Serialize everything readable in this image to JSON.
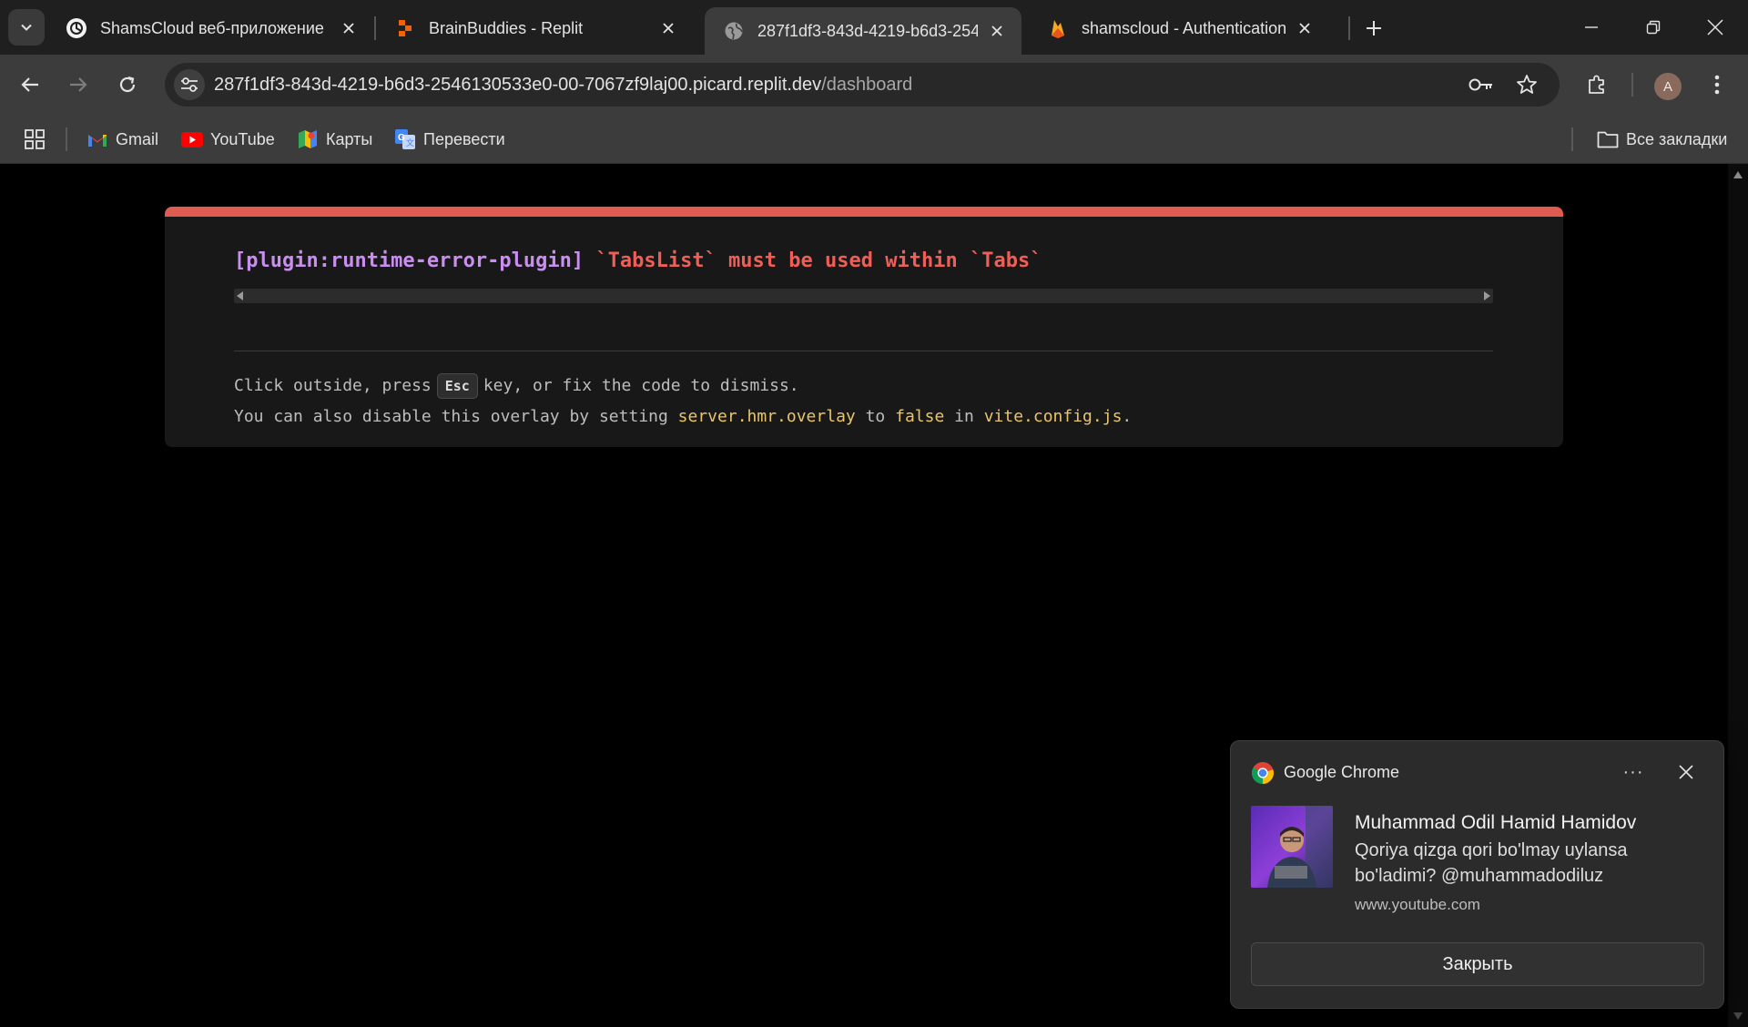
{
  "browser": {
    "tabs": [
      {
        "title": "ShamsCloud веб-приложение",
        "icon": "chatgpt-icon",
        "active": false
      },
      {
        "title": "BrainBuddies - Replit",
        "icon": "replit-icon",
        "active": false
      },
      {
        "title": "287f1df3-843d-4219-b6d3-254",
        "icon": "globe-icon",
        "active": true
      },
      {
        "title": "shamscloud - Authentication - S",
        "icon": "firebase-icon",
        "active": false
      }
    ],
    "url_host": "287f1df3-843d-4219-b6d3-2546130533e0-00-7067zf9laj00.picard.replit.dev",
    "url_path": "/dashboard",
    "profile_initial": "A",
    "bookmarks": [
      {
        "label": "Gmail",
        "icon": "gmail-icon"
      },
      {
        "label": "YouTube",
        "icon": "youtube-icon"
      },
      {
        "label": "Карты",
        "icon": "maps-icon"
      },
      {
        "label": "Перевести",
        "icon": "translate-icon"
      }
    ],
    "all_bookmarks_label": "Все закладки"
  },
  "overlay": {
    "plugin": "[plugin:runtime-error-plugin]",
    "message": "`TabsList` must be used within `Tabs`",
    "tip1_pre": "Click outside, press",
    "tip1_key": "Esc",
    "tip1_post": "key, or fix the code to dismiss.",
    "tip2_a": "You can also disable this overlay by setting",
    "tip2_b": "server.hmr.overlay",
    "tip2_c": "to",
    "tip2_d": "false",
    "tip2_e": "in",
    "tip2_f": "vite.config.js",
    "tip2_g": "."
  },
  "notification": {
    "app": "Google Chrome",
    "more": "···",
    "title": "Muhammad Odil Hamid Hamidov",
    "body": "Qoriya qizga qori bo'lmay uylansa bo'ladimi? @muhammadodiluz",
    "source": "www.youtube.com",
    "button": "Закрыть"
  },
  "colors": {
    "error_accent": "#e05b52",
    "plugin_text": "#c98ef0",
    "error_text": "#ef5e57",
    "highlight": "#e8c56a"
  }
}
